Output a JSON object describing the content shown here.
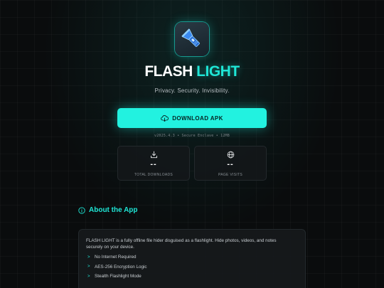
{
  "brand": {
    "title_part1": "FLASH",
    "title_part2": "LIGHT",
    "tagline": "Privacy. Security. Invisibility.",
    "logo_icon": "flashlight-icon"
  },
  "download": {
    "label": "DOWNLOAD APK",
    "icon": "cloud-download-icon",
    "version_info": "v2025.4.3 • Secure Enclave • 12MB"
  },
  "stats": [
    {
      "icon": "download-icon",
      "value": "--",
      "label": "TOTAL DOWNLOADS"
    },
    {
      "icon": "globe-icon",
      "value": "--",
      "label": "PAGE VISITS"
    }
  ],
  "about": {
    "icon": "info-icon",
    "heading": "About the App",
    "description": "FLASH LIGHT is a fully offline file hider disguised as a flashlight. Hide photos, videos, and notes securely on your device.",
    "features": [
      "No Internet Required",
      "AES-256 Encryption Logic",
      "Stealth Flashlight Mode"
    ]
  },
  "colors": {
    "accent": "#1fe6d6",
    "background": "#0a0c0d",
    "card": "#16191b"
  }
}
